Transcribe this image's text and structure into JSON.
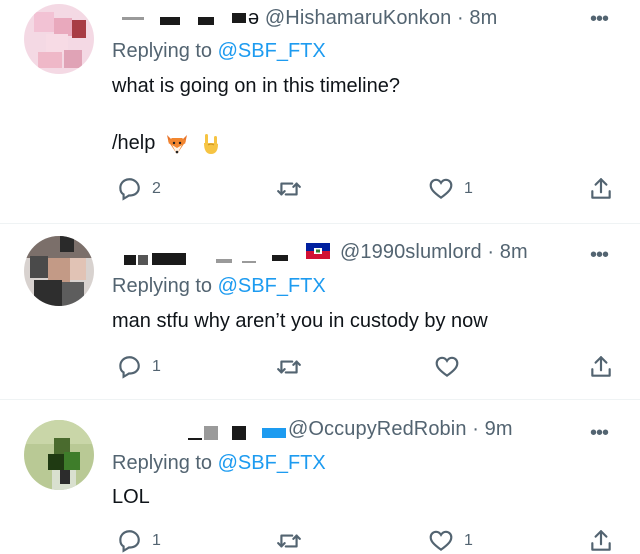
{
  "tweets": [
    {
      "handle": "@HishamaruKonkon",
      "time": "8m",
      "replying_prefix": "Replying to ",
      "replying_to": "@SBF_FTX",
      "text_line1": "what is going on in this timeline?",
      "text_line2": "/help",
      "reply_count": "2",
      "retweet_count": "",
      "like_count": "1"
    },
    {
      "handle": "@1990slumlord",
      "time": "8m",
      "replying_prefix": "Replying to ",
      "replying_to": "@SBF_FTX",
      "text_line1": "man stfu why aren’t you in custody by now",
      "reply_count": "1",
      "retweet_count": "",
      "like_count": ""
    },
    {
      "handle": "@OccupyRedRobin",
      "time": "9m",
      "replying_prefix": "Replying to ",
      "replying_to": "@SBF_FTX",
      "text_line1": "LOL",
      "reply_count": "1",
      "retweet_count": "",
      "like_count": "1"
    }
  ],
  "separator": " · ",
  "icons": {
    "reply": "reply-icon",
    "retweet": "retweet-icon",
    "like": "heart-icon",
    "share": "share-icon",
    "more": "more-icon"
  },
  "colors": {
    "accent": "#1d9bf0",
    "secondary_text": "#536471",
    "primary_text": "#0f1419"
  }
}
